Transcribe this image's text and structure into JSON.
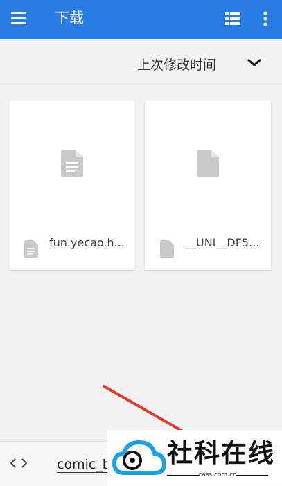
{
  "appbar": {
    "title": "下载",
    "menu_icon": "menu-icon",
    "view_icon": "list-view-icon",
    "more_icon": "more-vert-icon",
    "color": "#2a7be4"
  },
  "sort": {
    "label": "上次修改时间",
    "icon": "chevron-down-icon"
  },
  "files": [
    {
      "name": "fun.yecao.h...",
      "icon": "document-icon"
    },
    {
      "name": "__UNI__DF5...",
      "icon": "file-icon"
    }
  ],
  "bottom": {
    "code_icon": "code-icon",
    "filename_value": "comic_b"
  },
  "watermark": {
    "brand": "社科在线",
    "url": "cass.com.cn"
  }
}
